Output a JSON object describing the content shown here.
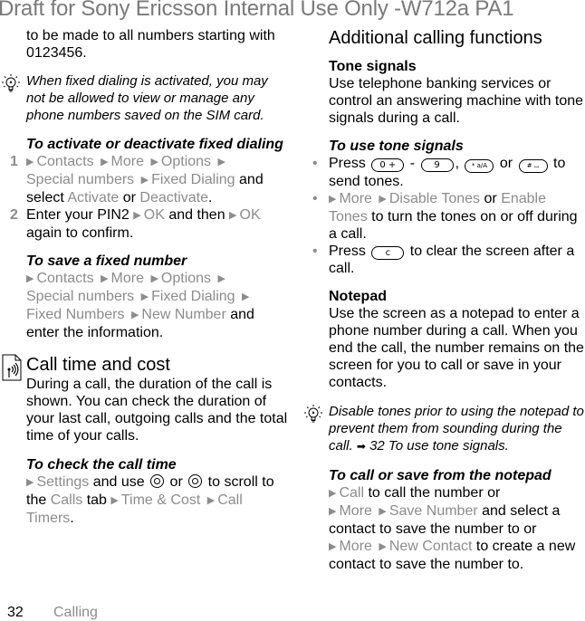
{
  "watermark": "Draft for Sony Ericsson Internal Use Only -W712a PA1",
  "left": {
    "intro": "to be made to all numbers starting with 0123456.",
    "note1": "When fixed dialing is activated, you may not be allowed to view or manage any phone numbers saved on the SIM card.",
    "activate": {
      "title": "To activate or deactivate fixed dialing",
      "step1": {
        "num": "1",
        "m1": "Contacts",
        "m2": "More",
        "m3": "Options",
        "m4": "Special numbers",
        "m5": "Fixed Dialing",
        "t1": " and select ",
        "o1": "Activate",
        "t2": " or ",
        "o2": "Deactivate",
        "t3": "."
      },
      "step2": {
        "num": "2",
        "t1": "Enter your PIN2 ",
        "m1": "OK",
        "t2": " and then ",
        "m2": "OK",
        "t3": " again to confirm."
      }
    },
    "save_fixed": {
      "title": "To save a fixed number",
      "m1": "Contacts",
      "m2": "More",
      "m3": "Options",
      "m4": "Special numbers",
      "m5": "Fixed Dialing",
      "m6": "Fixed Numbers",
      "m7": "New Number",
      "t1": " and enter the information."
    },
    "call_time": {
      "heading": "Call time and cost",
      "body": "During a call, the duration of the call is shown. You can check the duration of your last call, outgoing calls and the total time of your calls."
    },
    "check_time": {
      "title": "To check the call time",
      "m1": "Settings",
      "t1": " and use ",
      "t2": " or ",
      "t3": " to scroll to the ",
      "m2": "Calls",
      "t4": " tab ",
      "m3": "Time & Cost",
      "m4": "Call Timers",
      "t5": "."
    }
  },
  "right": {
    "heading": "Additional calling functions",
    "tone": {
      "title": "Tone signals",
      "body": "Use telephone banking services or control an answering machine with tone signals during a call."
    },
    "use_tone": {
      "title": "To use tone signals",
      "b1": {
        "t1": "Press ",
        "k1": "0 +",
        "t2": " - ",
        "k2": "9",
        "t3": ", ",
        "k3": "* a/A",
        "t4": " or ",
        "k4": "# ⌴",
        "t5": " to send tones."
      },
      "b2": {
        "m1": "More",
        "m2": "Disable Tones",
        "t1": " or ",
        "m3": "Enable Tones",
        "t2": " to turn the tones on or off during a call."
      },
      "b3": {
        "t1": "Press ",
        "k1": "c",
        "t2": " to clear the screen after a call."
      }
    },
    "notepad": {
      "title": "Notepad",
      "body": "Use the screen as a notepad to enter a phone number during a call. When you end the call, the number remains on the screen for you to call or save in your contacts."
    },
    "note2": {
      "t1": "Disable tones prior to using the notepad to prevent them from sounding during the call. ",
      "ref": "32 To use tone signals."
    },
    "call_save": {
      "title": "To call or save from the notepad",
      "m1": "Call",
      "t1": " to call the number or",
      "m2": "More",
      "m3": "Save Number",
      "t2": " and select a contact to save the number to or",
      "m4": "More",
      "m5": "New Contact",
      "t3": " to create a new contact to save the number to."
    }
  },
  "footer": {
    "page": "32",
    "chapter": "Calling"
  }
}
